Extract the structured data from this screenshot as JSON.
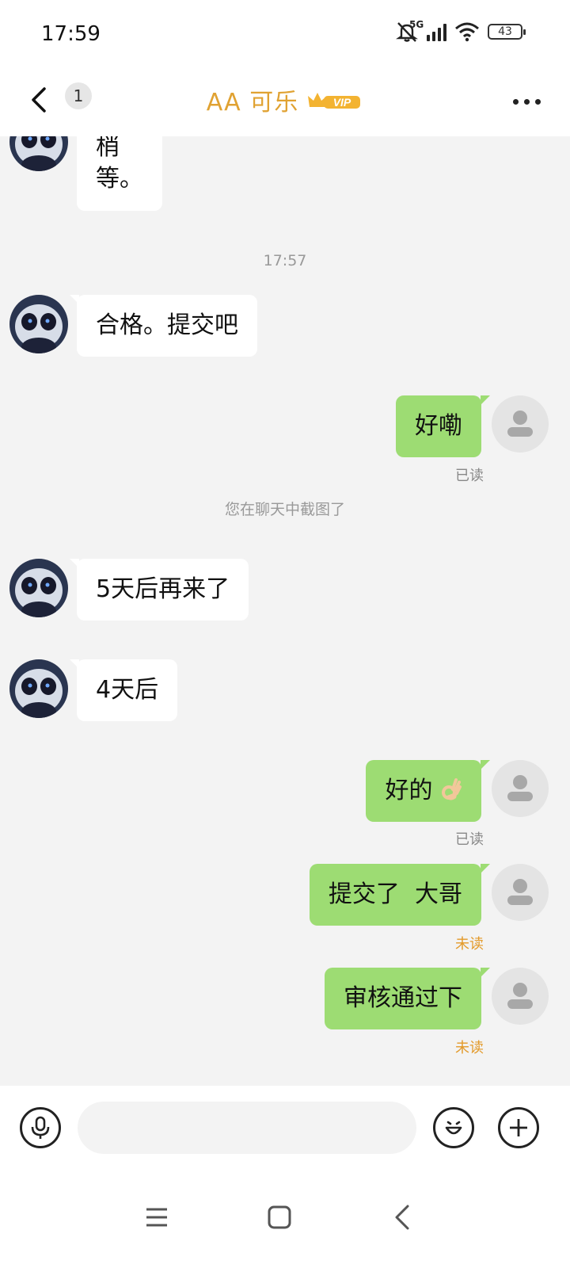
{
  "status_bar": {
    "time": "17:59",
    "network": "5G",
    "battery": "43"
  },
  "header": {
    "back_count": "1",
    "title": "AA 可乐",
    "vip_badge": "VIP"
  },
  "messages": [
    {
      "side": "in",
      "text_line1": "梢",
      "text_line2": "等。"
    },
    {
      "side": "time",
      "text": "17:57"
    },
    {
      "side": "in",
      "text": "合格。提交吧"
    },
    {
      "side": "out",
      "text": "好嘞",
      "status": "已读"
    },
    {
      "side": "system",
      "text": "您在聊天中截图了"
    },
    {
      "side": "in",
      "text": "5天后再来了"
    },
    {
      "side": "in",
      "text": "4天后"
    },
    {
      "side": "out",
      "text": "好的",
      "emoji": "ok-hand-icon",
      "status": "已读"
    },
    {
      "side": "out",
      "text": "提交了  大哥",
      "status": "未读"
    },
    {
      "side": "out",
      "text": "审核通过下",
      "status": "未读"
    }
  ],
  "input": {
    "placeholder": ""
  },
  "colors": {
    "outgoing_bubble": "#9ddc73",
    "incoming_bubble": "#ffffff",
    "title": "#e0a232",
    "unread": "#e39a2a"
  }
}
